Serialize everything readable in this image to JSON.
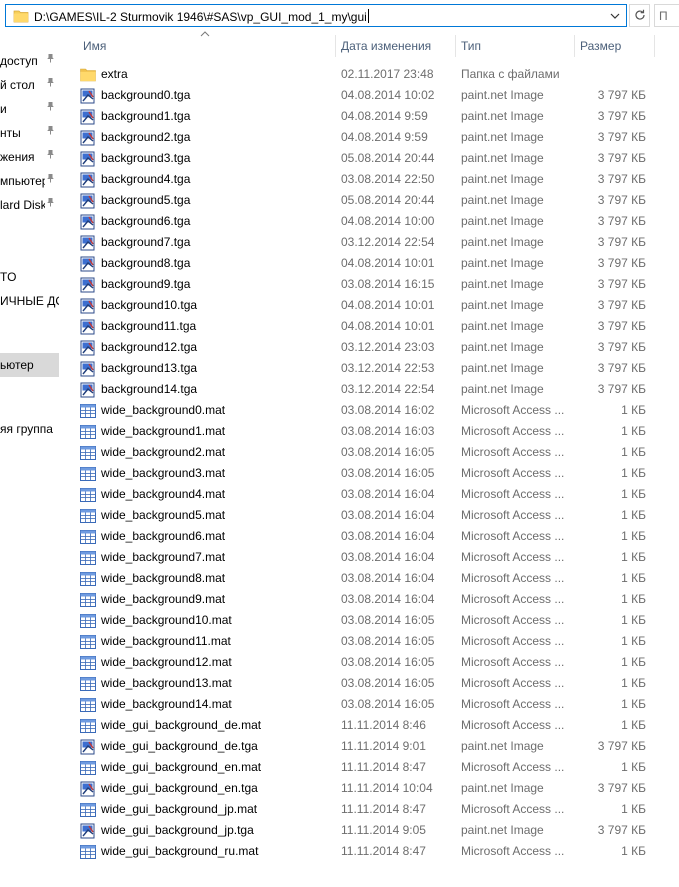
{
  "address_bar": {
    "path": "D:\\GAMES\\IL-2 Sturmovik 1946\\#SAS\\vp_GUI_mod_1_my\\gui",
    "dropdown_icon": "chevron-down-icon",
    "refresh_icon": "refresh-icon",
    "search_placeholder": "П"
  },
  "nav": {
    "items": [
      {
        "label": "доступ",
        "pinned": true
      },
      {
        "label": "й стол",
        "pinned": true
      },
      {
        "label": "и",
        "pinned": true
      },
      {
        "label": "нты",
        "pinned": true
      },
      {
        "label": "жения",
        "pinned": true
      },
      {
        "label": "мпьютер",
        "pinned": true
      },
      {
        "label": "lard Disk",
        "pinned": true
      },
      {
        "label": "",
        "pinned": false
      },
      {
        "label": "TO",
        "pinned": false
      },
      {
        "label": "ИЧНЫЕ ДО",
        "pinned": false
      },
      {
        "label": "",
        "pinned": false
      },
      {
        "label": "ьютер",
        "pinned": false,
        "selected": true
      },
      {
        "label": "",
        "pinned": false
      },
      {
        "label": "",
        "pinned": false
      },
      {
        "label": "яя группа",
        "pinned": false
      }
    ],
    "pin_icon": "pin-icon"
  },
  "columns": {
    "name": "Имя",
    "date": "Дата изменения",
    "type": "Тип",
    "size": "Размер"
  },
  "files": [
    {
      "name": "extra",
      "date": "02.11.2017 23:48",
      "type": "Папка с файлами",
      "size": "",
      "icon": "folder-icon"
    },
    {
      "name": "background0.tga",
      "date": "04.08.2014 10:02",
      "type": "paint.net Image",
      "size": "3 797 КБ",
      "icon": "image-file-icon"
    },
    {
      "name": "background1.tga",
      "date": "04.08.2014 9:59",
      "type": "paint.net Image",
      "size": "3 797 КБ",
      "icon": "image-file-icon"
    },
    {
      "name": "background2.tga",
      "date": "04.08.2014 9:59",
      "type": "paint.net Image",
      "size": "3 797 КБ",
      "icon": "image-file-icon"
    },
    {
      "name": "background3.tga",
      "date": "05.08.2014 20:44",
      "type": "paint.net Image",
      "size": "3 797 КБ",
      "icon": "image-file-icon"
    },
    {
      "name": "background4.tga",
      "date": "03.08.2014 22:50",
      "type": "paint.net Image",
      "size": "3 797 КБ",
      "icon": "image-file-icon"
    },
    {
      "name": "background5.tga",
      "date": "05.08.2014 20:44",
      "type": "paint.net Image",
      "size": "3 797 КБ",
      "icon": "image-file-icon"
    },
    {
      "name": "background6.tga",
      "date": "04.08.2014 10:00",
      "type": "paint.net Image",
      "size": "3 797 КБ",
      "icon": "image-file-icon"
    },
    {
      "name": "background7.tga",
      "date": "03.12.2014 22:54",
      "type": "paint.net Image",
      "size": "3 797 КБ",
      "icon": "image-file-icon"
    },
    {
      "name": "background8.tga",
      "date": "04.08.2014 10:01",
      "type": "paint.net Image",
      "size": "3 797 КБ",
      "icon": "image-file-icon"
    },
    {
      "name": "background9.tga",
      "date": "03.08.2014 16:15",
      "type": "paint.net Image",
      "size": "3 797 КБ",
      "icon": "image-file-icon"
    },
    {
      "name": "background10.tga",
      "date": "04.08.2014 10:01",
      "type": "paint.net Image",
      "size": "3 797 КБ",
      "icon": "image-file-icon"
    },
    {
      "name": "background11.tga",
      "date": "04.08.2014 10:01",
      "type": "paint.net Image",
      "size": "3 797 КБ",
      "icon": "image-file-icon"
    },
    {
      "name": "background12.tga",
      "date": "03.12.2014 23:03",
      "type": "paint.net Image",
      "size": "3 797 КБ",
      "icon": "image-file-icon"
    },
    {
      "name": "background13.tga",
      "date": "03.12.2014 22:53",
      "type": "paint.net Image",
      "size": "3 797 КБ",
      "icon": "image-file-icon"
    },
    {
      "name": "background14.tga",
      "date": "03.12.2014 22:54",
      "type": "paint.net Image",
      "size": "3 797 КБ",
      "icon": "image-file-icon"
    },
    {
      "name": "wide_background0.mat",
      "date": "03.08.2014 16:02",
      "type": "Microsoft Access ...",
      "size": "1 КБ",
      "icon": "table-file-icon"
    },
    {
      "name": "wide_background1.mat",
      "date": "03.08.2014 16:03",
      "type": "Microsoft Access ...",
      "size": "1 КБ",
      "icon": "table-file-icon"
    },
    {
      "name": "wide_background2.mat",
      "date": "03.08.2014 16:05",
      "type": "Microsoft Access ...",
      "size": "1 КБ",
      "icon": "table-file-icon"
    },
    {
      "name": "wide_background3.mat",
      "date": "03.08.2014 16:05",
      "type": "Microsoft Access ...",
      "size": "1 КБ",
      "icon": "table-file-icon"
    },
    {
      "name": "wide_background4.mat",
      "date": "03.08.2014 16:04",
      "type": "Microsoft Access ...",
      "size": "1 КБ",
      "icon": "table-file-icon"
    },
    {
      "name": "wide_background5.mat",
      "date": "03.08.2014 16:04",
      "type": "Microsoft Access ...",
      "size": "1 КБ",
      "icon": "table-file-icon"
    },
    {
      "name": "wide_background6.mat",
      "date": "03.08.2014 16:04",
      "type": "Microsoft Access ...",
      "size": "1 КБ",
      "icon": "table-file-icon"
    },
    {
      "name": "wide_background7.mat",
      "date": "03.08.2014 16:04",
      "type": "Microsoft Access ...",
      "size": "1 КБ",
      "icon": "table-file-icon"
    },
    {
      "name": "wide_background8.mat",
      "date": "03.08.2014 16:04",
      "type": "Microsoft Access ...",
      "size": "1 КБ",
      "icon": "table-file-icon"
    },
    {
      "name": "wide_background9.mat",
      "date": "03.08.2014 16:04",
      "type": "Microsoft Access ...",
      "size": "1 КБ",
      "icon": "table-file-icon"
    },
    {
      "name": "wide_background10.mat",
      "date": "03.08.2014 16:05",
      "type": "Microsoft Access ...",
      "size": "1 КБ",
      "icon": "table-file-icon"
    },
    {
      "name": "wide_background11.mat",
      "date": "03.08.2014 16:05",
      "type": "Microsoft Access ...",
      "size": "1 КБ",
      "icon": "table-file-icon"
    },
    {
      "name": "wide_background12.mat",
      "date": "03.08.2014 16:05",
      "type": "Microsoft Access ...",
      "size": "1 КБ",
      "icon": "table-file-icon"
    },
    {
      "name": "wide_background13.mat",
      "date": "03.08.2014 16:05",
      "type": "Microsoft Access ...",
      "size": "1 КБ",
      "icon": "table-file-icon"
    },
    {
      "name": "wide_background14.mat",
      "date": "03.08.2014 16:05",
      "type": "Microsoft Access ...",
      "size": "1 КБ",
      "icon": "table-file-icon"
    },
    {
      "name": "wide_gui_background_de.mat",
      "date": "11.11.2014 8:46",
      "type": "Microsoft Access ...",
      "size": "1 КБ",
      "icon": "table-file-icon"
    },
    {
      "name": "wide_gui_background_de.tga",
      "date": "11.11.2014 9:01",
      "type": "paint.net Image",
      "size": "3 797 КБ",
      "icon": "image-file-icon"
    },
    {
      "name": "wide_gui_background_en.mat",
      "date": "11.11.2014 8:47",
      "type": "Microsoft Access ...",
      "size": "1 КБ",
      "icon": "table-file-icon"
    },
    {
      "name": "wide_gui_background_en.tga",
      "date": "11.11.2014 10:04",
      "type": "paint.net Image",
      "size": "3 797 КБ",
      "icon": "image-file-icon"
    },
    {
      "name": "wide_gui_background_jp.mat",
      "date": "11.11.2014 8:47",
      "type": "Microsoft Access ...",
      "size": "1 КБ",
      "icon": "table-file-icon"
    },
    {
      "name": "wide_gui_background_jp.tga",
      "date": "11.11.2014 9:05",
      "type": "paint.net Image",
      "size": "3 797 КБ",
      "icon": "image-file-icon"
    },
    {
      "name": "wide_gui_background_ru.mat",
      "date": "11.11.2014 8:47",
      "type": "Microsoft Access ...",
      "size": "1 КБ",
      "icon": "table-file-icon"
    }
  ],
  "colors": {
    "accent": "#0078d7",
    "header_text": "#4c607a",
    "secondary_text": "#6d6d6d",
    "folder": "#f6cf5b",
    "selected_nav": "#d9d9d9"
  }
}
